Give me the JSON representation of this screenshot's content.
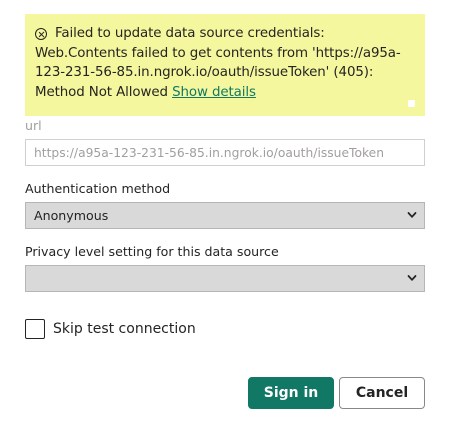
{
  "error": {
    "message": "Failed to update data source credentials: Web.Contents failed to get contents from 'https://a95a-123-231-56-85.in.ngrok.io/oauth/issueToken' (405): Method Not Allowed",
    "link_label": "Show details",
    "icon": "circle-x-icon"
  },
  "url_field": {
    "label": "url",
    "placeholder": "https://a95a-123-231-56-85.in.ngrok.io/oauth/issueToken"
  },
  "auth_method": {
    "label": "Authentication method",
    "value": "Anonymous"
  },
  "privacy_level": {
    "label": "Privacy level setting for this data source",
    "value": ""
  },
  "skip_test": {
    "label": "Skip test connection",
    "checked": false
  },
  "buttons": {
    "sign_in": "Sign in",
    "cancel": "Cancel"
  },
  "colors": {
    "banner_bg": "#f4f79d",
    "accent": "#117865",
    "select_bg": "#d9d9d9"
  }
}
